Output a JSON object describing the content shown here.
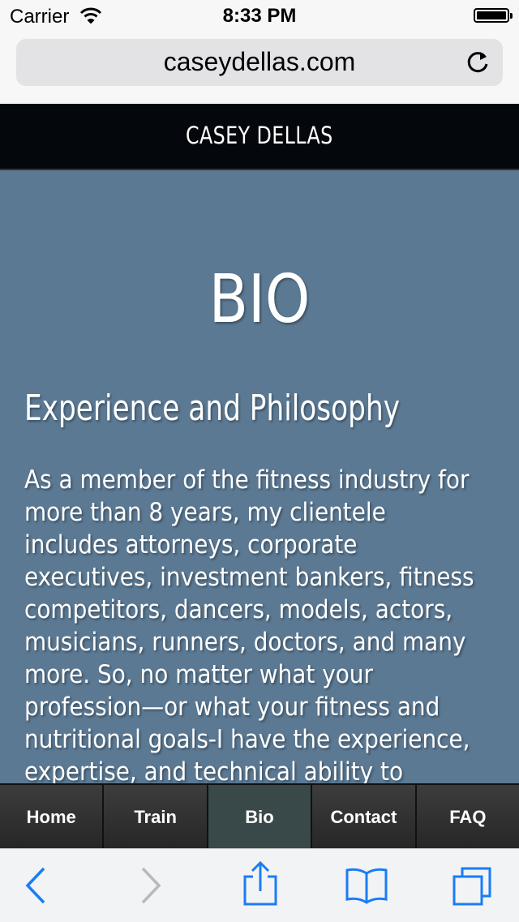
{
  "status_bar": {
    "carrier": "Carrier",
    "time": "8:33 PM",
    "wifi_icon": "wifi-icon",
    "battery_icon": "battery-icon"
  },
  "browser": {
    "url": "caseydellas.com",
    "reload_icon": "reload-icon"
  },
  "site": {
    "brand": "CASEY DELLAS"
  },
  "page": {
    "title": "BIO",
    "section_heading": "Experience and Philosophy",
    "paragraph_lines": [
      "As a member of the fitness industry for",
      "more than 8 years, my clientele",
      "includes attorneys, corporate",
      "executives, investment bankers, fitness",
      "competitors, dancers, models, actors,",
      "musicians, runners, doctors, and many",
      "more. So, no matter what your",
      "profession—or what your fitness and",
      "nutritional goals-I have the experience,",
      "expertise, and technical ability to"
    ]
  },
  "nav": {
    "items": [
      {
        "label": "Home"
      },
      {
        "label": "Train"
      },
      {
        "label": "Bio",
        "active": true
      },
      {
        "label": "Contact"
      },
      {
        "label": "FAQ"
      }
    ]
  },
  "toolbar": {
    "icons": [
      "back-icon",
      "forward-icon",
      "share-icon",
      "bookmarks-icon",
      "tabs-icon"
    ]
  },
  "colors": {
    "content_bg": "#5b7993",
    "header_bg": "#04080c",
    "nav_active": "#394848",
    "ios_blue": "#1a7cf5"
  }
}
